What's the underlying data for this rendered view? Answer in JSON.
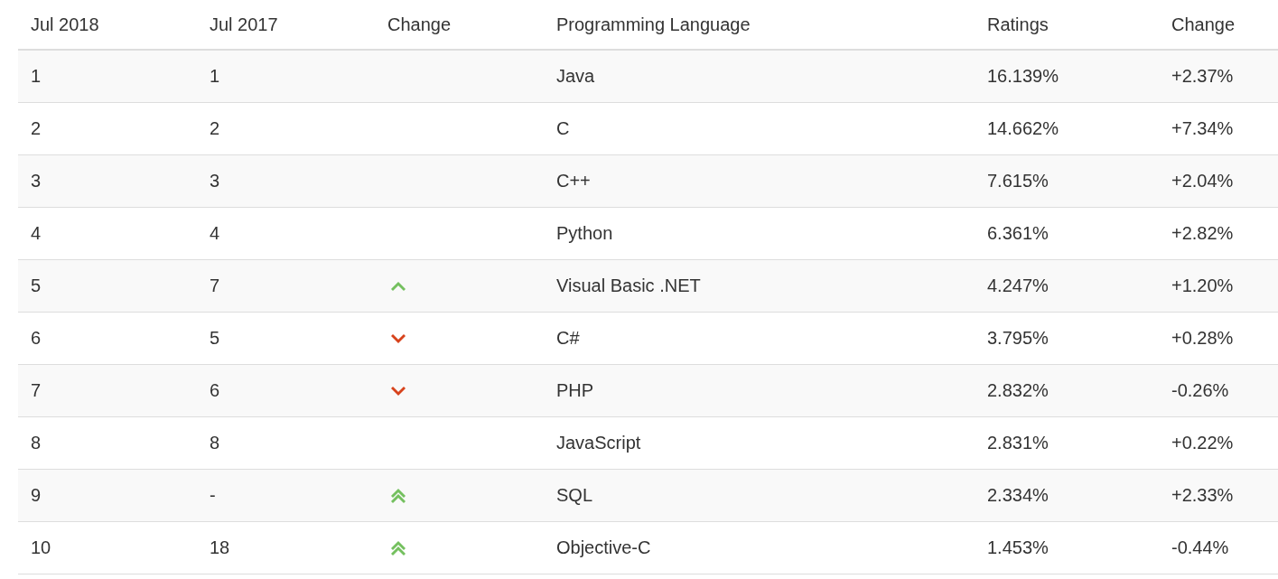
{
  "table": {
    "columns": [
      "Jul 2018",
      "Jul 2017",
      "Change",
      "Programming Language",
      "Ratings",
      "Change"
    ],
    "rows": [
      {
        "rank_2018": "1",
        "rank_2017": "1",
        "language": "Java",
        "rating": "16.139%",
        "change": "+2.37%"
      },
      {
        "rank_2018": "2",
        "rank_2017": "2",
        "language": "C",
        "rating": "14.662%",
        "change": "+7.34%"
      },
      {
        "rank_2018": "3",
        "rank_2017": "3",
        "language": "C++",
        "rating": "7.615%",
        "change": "+2.04%"
      },
      {
        "rank_2018": "4",
        "rank_2017": "4",
        "language": "Python",
        "rating": "6.361%",
        "change": "+2.82%"
      },
      {
        "rank_2018": "5",
        "rank_2017": "7",
        "kind": "up",
        "language": "Visual Basic .NET",
        "rating": "4.247%",
        "change": "+1.20%"
      },
      {
        "rank_2018": "6",
        "rank_2017": "5",
        "kind": "down",
        "language": "C#",
        "rating": "3.795%",
        "change": "+0.28%"
      },
      {
        "rank_2018": "7",
        "rank_2017": "6",
        "kind": "down",
        "language": "PHP",
        "rating": "2.832%",
        "change": "-0.26%"
      },
      {
        "rank_2018": "8",
        "rank_2017": "8",
        "language": "JavaScript",
        "rating": "2.831%",
        "change": "+0.22%"
      },
      {
        "rank_2018": "9",
        "rank_2017": "-",
        "kind": "doubleup",
        "language": "SQL",
        "rating": "2.334%",
        "change": "+2.33%"
      },
      {
        "rank_2018": "10",
        "rank_2017": "18",
        "kind": "doubleup",
        "language": "Objective-C",
        "rating": "1.453%",
        "change": "-0.44%"
      }
    ]
  }
}
